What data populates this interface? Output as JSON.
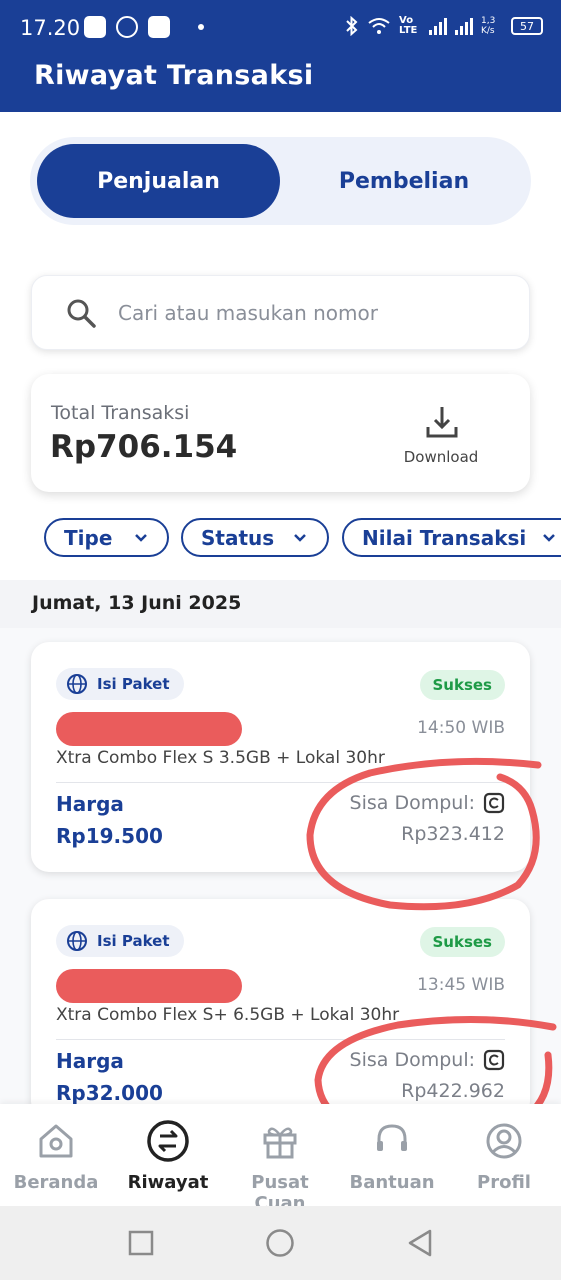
{
  "statusbar": {
    "time": "17.20",
    "network": "Vo LTE",
    "speed": "1,3 K/s",
    "battery": "57"
  },
  "header": {
    "title": "Riwayat Transaksi"
  },
  "toggle": {
    "active": "Penjualan",
    "inactive": "Pembelian"
  },
  "search": {
    "placeholder": "Cari atau masukan nomor",
    "icon": "search-icon"
  },
  "summary": {
    "label": "Total Transaksi",
    "value": "Rp706.154",
    "download_label": "Download"
  },
  "filters": [
    {
      "label": "Tipe"
    },
    {
      "label": "Status"
    },
    {
      "label": "Nilai Transaksi"
    }
  ],
  "date_group": "Jumat, 13 Juni 2025",
  "transactions": [
    {
      "category": "Isi Paket",
      "status": "Sukses",
      "time": "14:50 WIB",
      "product": "Xtra Combo Flex S 3.5GB + Lokal 30hr",
      "price_label": "Harga",
      "price": "Rp19.500",
      "balance_label": "Sisa Dompul:",
      "balance": "Rp323.412"
    },
    {
      "category": "Isi Paket",
      "status": "Sukses",
      "time": "13:45 WIB",
      "product": "Xtra Combo Flex S+ 6.5GB + Lokal 30hr",
      "price_label": "Harga",
      "price": "Rp32.000",
      "balance_label": "Sisa Dompul:",
      "balance": "Rp422.962"
    }
  ],
  "bottom_nav": [
    {
      "label": "Beranda",
      "icon": "home-icon"
    },
    {
      "label": "Riwayat",
      "icon": "history-icon",
      "active": true
    },
    {
      "label": "Pusat Cuan",
      "icon": "gift-icon"
    },
    {
      "label": "Bantuan",
      "icon": "headset-icon"
    },
    {
      "label": "Profil",
      "icon": "profile-icon"
    }
  ],
  "colors": {
    "primary": "#1a3f96",
    "success_bg": "#dff5e6",
    "success_text": "#1e9a46",
    "annotation_red": "#ea5c5c"
  }
}
